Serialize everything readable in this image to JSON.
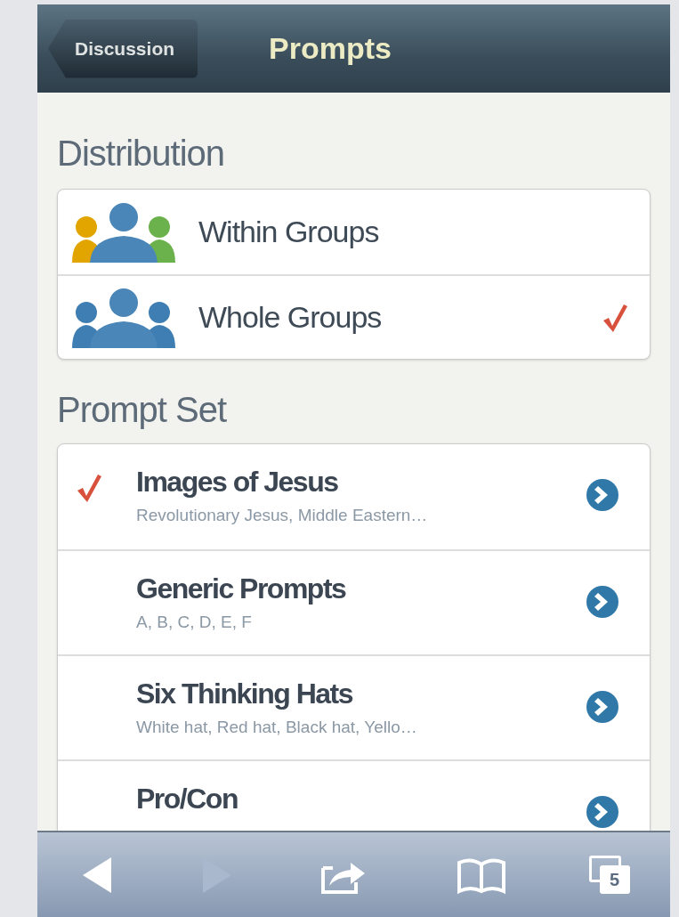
{
  "nav": {
    "back": "Discussion",
    "title": "Prompts"
  },
  "distribution": {
    "heading": "Distribution",
    "items": [
      {
        "label": "Within Groups",
        "kind": "mixed",
        "selected": false
      },
      {
        "label": "Whole Groups",
        "kind": "uniform",
        "selected": true
      }
    ]
  },
  "prompt_set": {
    "heading": "Prompt Set",
    "items": [
      {
        "title": "Images of Jesus",
        "subtitle": "Revolutionary Jesus, Middle Eastern…",
        "selected": true
      },
      {
        "title": "Generic Prompts",
        "subtitle": "A, B, C, D, E, F",
        "selected": false
      },
      {
        "title": "Six Thinking Hats",
        "subtitle": "White hat, Red hat, Black hat, Yello…",
        "selected": false
      },
      {
        "title": "Pro/Con",
        "selected": false
      }
    ]
  },
  "toolbar": [
    {
      "kind": "back",
      "disabled": false
    },
    {
      "kind": "forward",
      "disabled": true
    },
    {
      "kind": "share",
      "disabled": false
    },
    {
      "kind": "bookmarks",
      "disabled": false
    },
    {
      "kind": "tabs",
      "disabled": false,
      "count": "5"
    }
  ]
}
